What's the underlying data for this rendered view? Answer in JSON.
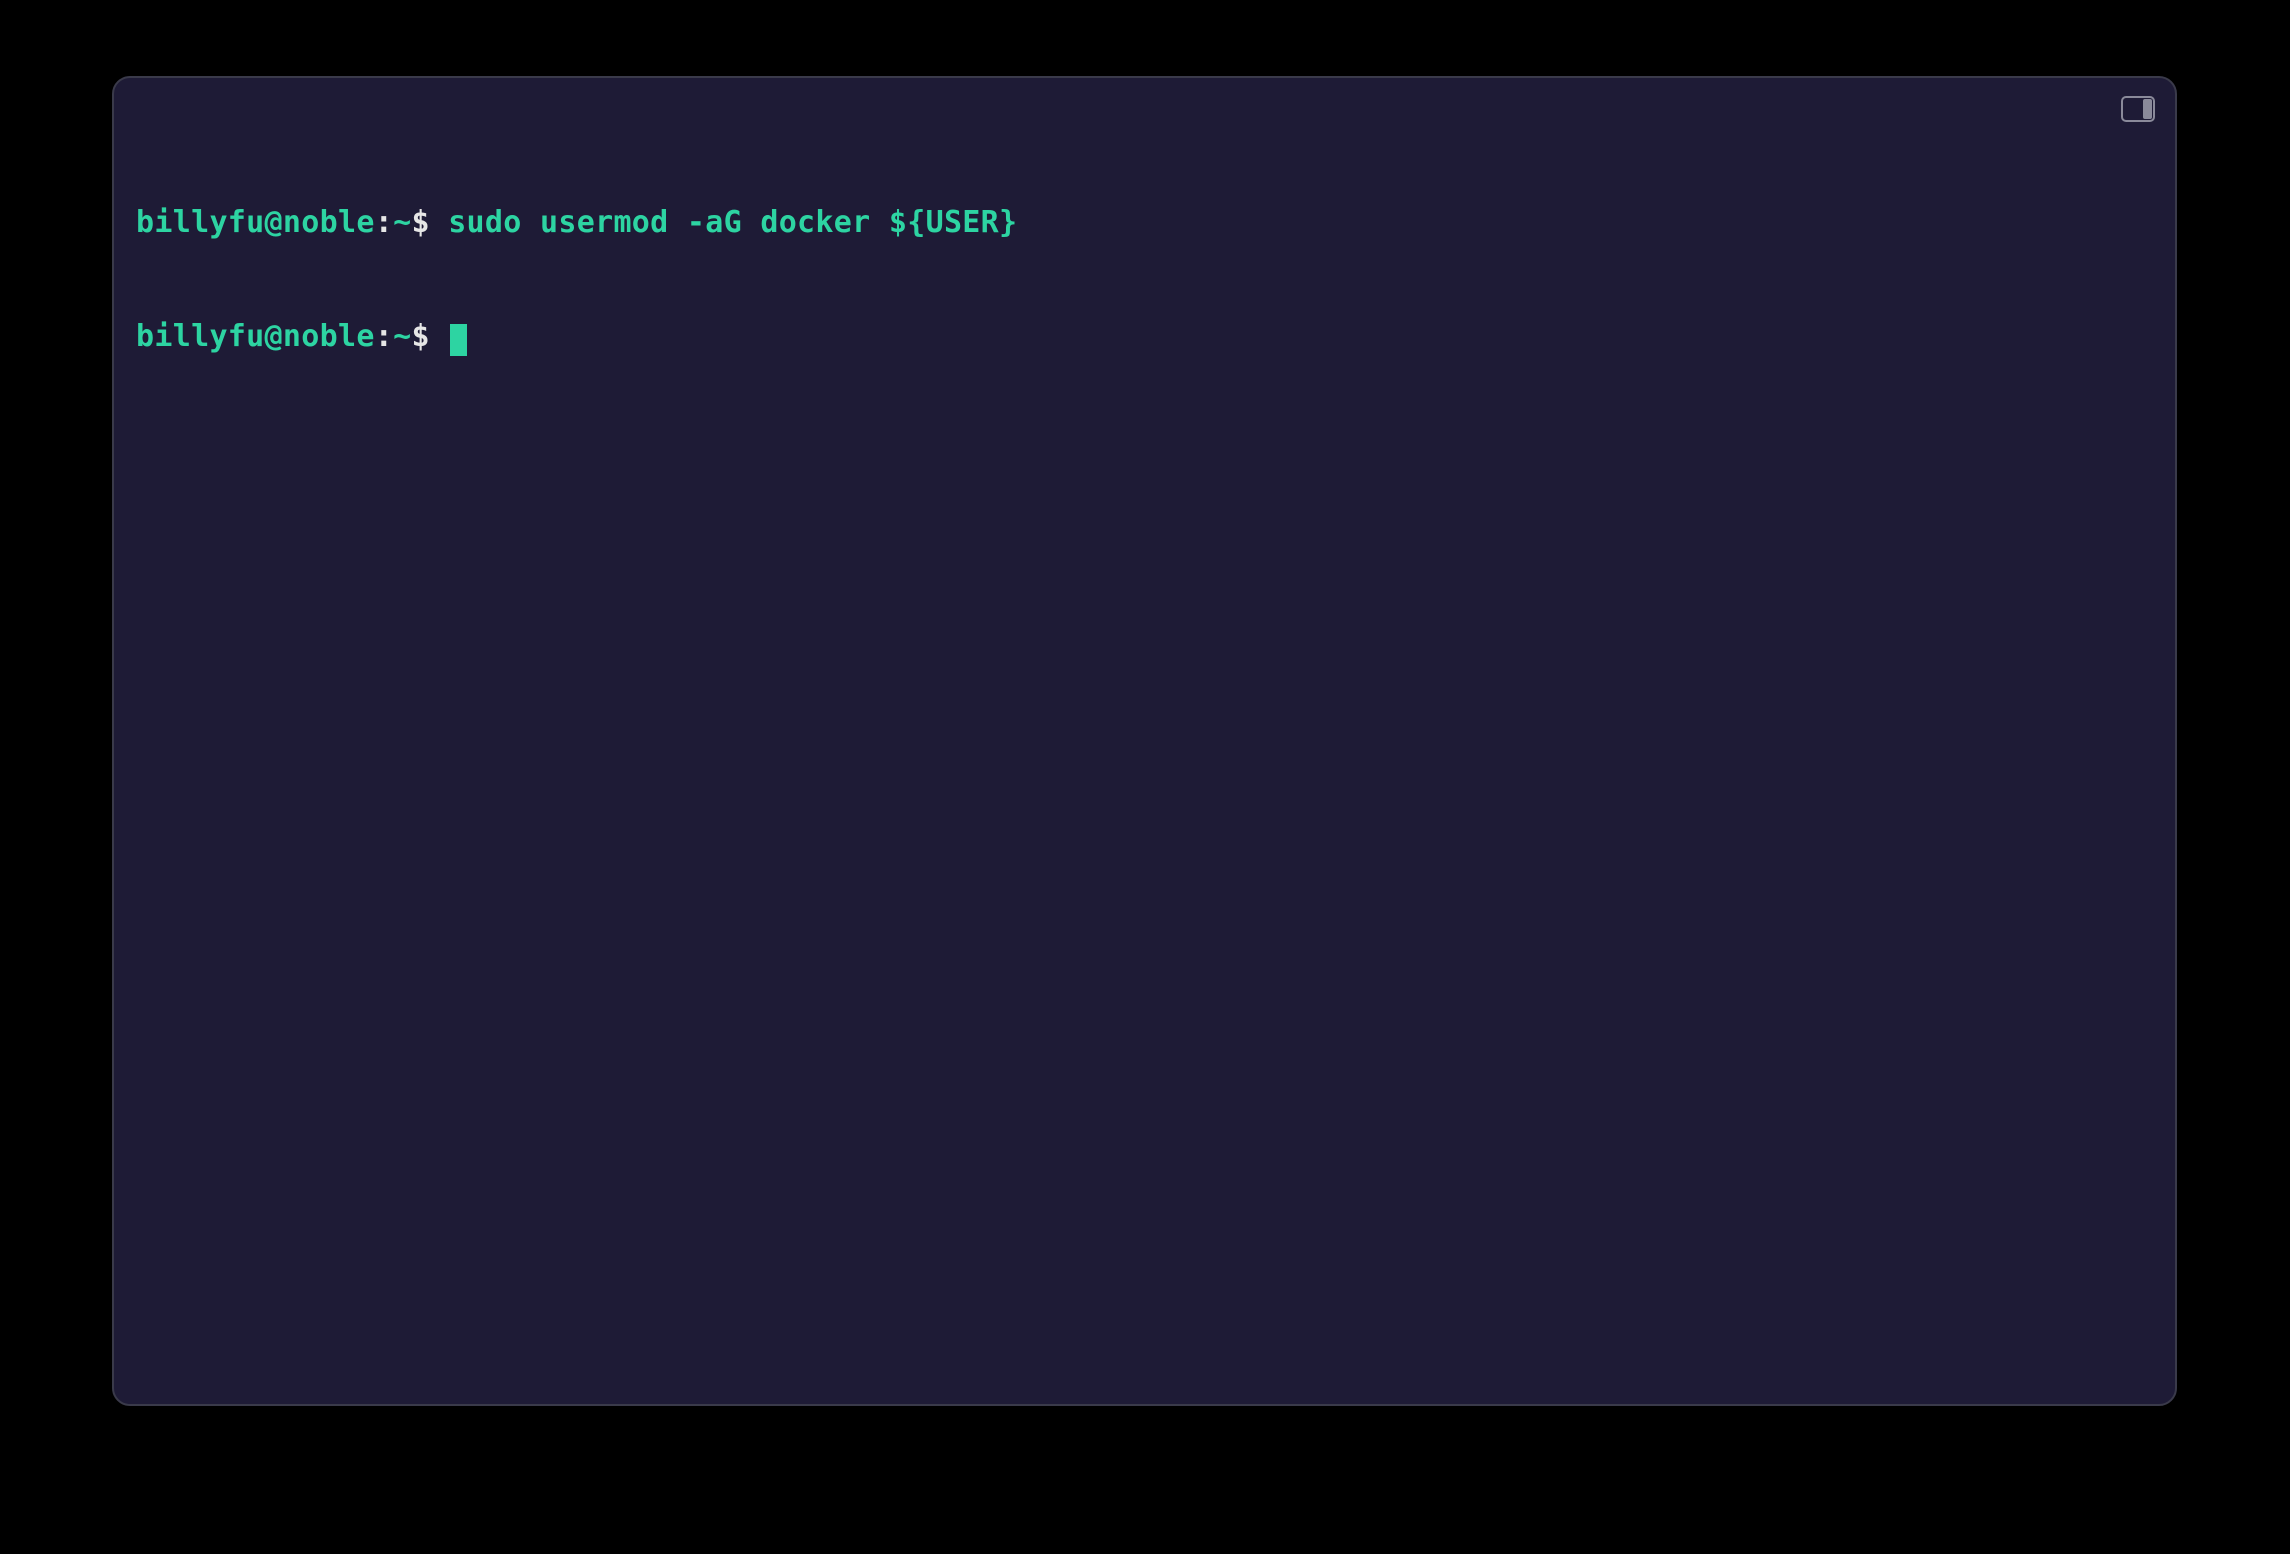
{
  "terminal": {
    "colors": {
      "background": "#1e1b36",
      "prompt_green": "#2dd4a2",
      "text_white": "#e6e6e6",
      "window_border": "#3a3a4a",
      "page_background": "#000000"
    },
    "lines": [
      {
        "user_host": "billyfu@noble",
        "separator": ":",
        "path": "~",
        "dollar": "$",
        "command": " sudo usermod -aG docker ${USER}"
      },
      {
        "user_host": "billyfu@noble",
        "separator": ":",
        "path": "~",
        "dollar": "$",
        "command": " "
      }
    ],
    "icon": "panel-right-icon"
  }
}
